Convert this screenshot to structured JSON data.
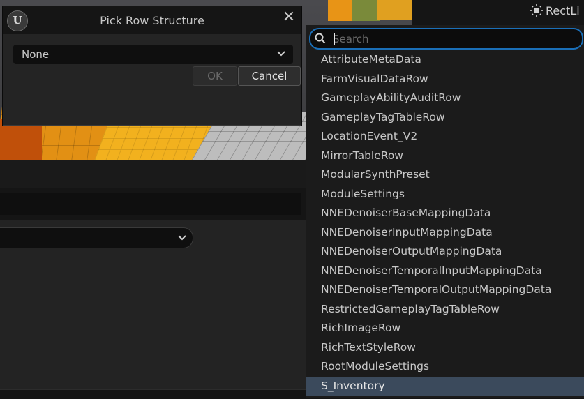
{
  "dialog": {
    "title": "Pick Row Structure",
    "close_glyph": "✕",
    "logo_letter": "U",
    "struct_select_value": "None",
    "ok_label": "OK",
    "cancel_label": "Cancel"
  },
  "toolbar": {
    "rect_light_label": "RectLi"
  },
  "picker": {
    "search_placeholder": "Search",
    "search_value": "",
    "options": [
      "AttributeMetaData",
      "FarmVisualDataRow",
      "GameplayAbilityAuditRow",
      "GameplayTagTableRow",
      "LocationEvent_V2",
      "MirrorTableRow",
      "ModularSynthPreset",
      "ModuleSettings",
      "NNEDenoiserBaseMappingData",
      "NNEDenoiserInputMappingData",
      "NNEDenoiserOutputMappingData",
      "NNEDenoiserTemporalInputMappingData",
      "NNEDenoiserTemporalOutputMappingData",
      "RestrictedGameplayTagTableRow",
      "RichImageRow",
      "RichTextStyleRow",
      "RootModuleSettings",
      "S_Inventory"
    ],
    "selected_option": "S_Inventory"
  },
  "colors": {
    "focus_border": "#1a6fb8",
    "selected_row": "#3b4a5c",
    "dialog_bg": "#242424"
  },
  "icons": {
    "logo": "unreal-engine-logo-icon",
    "close": "close-icon",
    "chevron": "chevron-down-icon",
    "search": "search-icon",
    "light": "rect-light-icon"
  }
}
